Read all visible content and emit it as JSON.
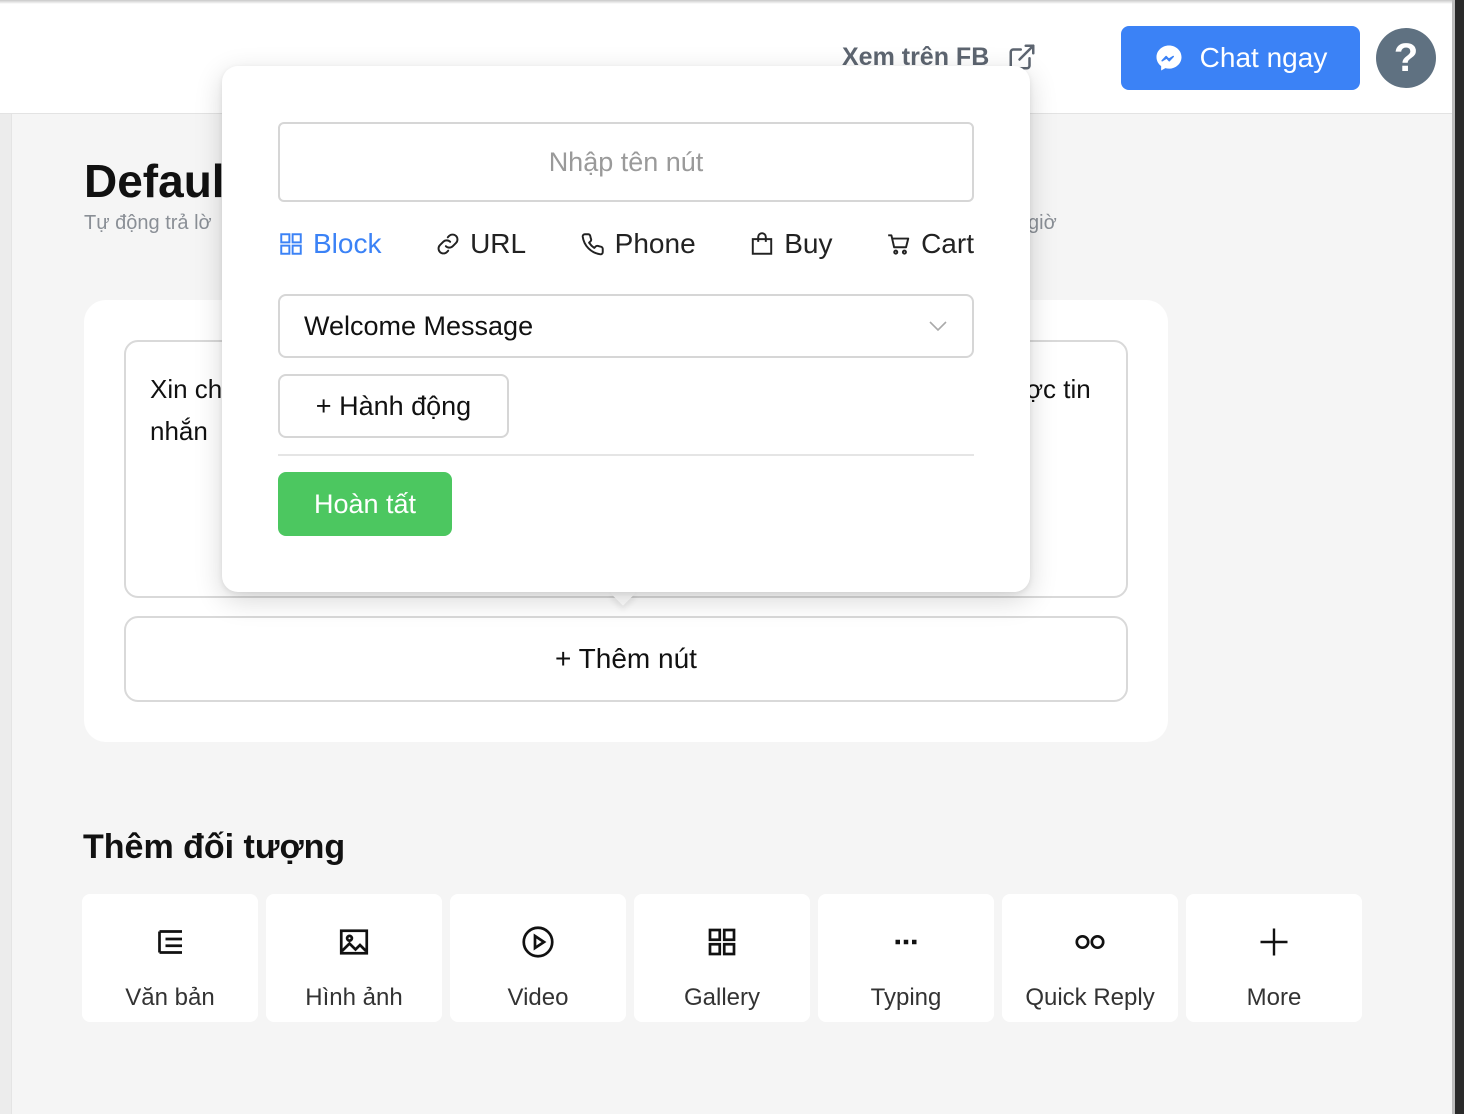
{
  "header": {
    "view_on_fb": "Xem trên FB",
    "chat_button": "Chat ngay",
    "help": "?"
  },
  "page": {
    "title": "Default",
    "subtitle": "Tự động trả lờ",
    "subtitle_tail": "giờ"
  },
  "message": {
    "text": "Xin ch",
    "text_line2": "nhắn",
    "text_tail": "ợc tin"
  },
  "add_button": "+ Thêm nút",
  "popover": {
    "name_placeholder": "Nhập tên nút",
    "name_value": "",
    "tabs": [
      {
        "label": "Block",
        "icon": "grid-icon",
        "active": true
      },
      {
        "label": "URL",
        "icon": "link-icon"
      },
      {
        "label": "Phone",
        "icon": "phone-icon"
      },
      {
        "label": "Buy",
        "icon": "bag-icon"
      },
      {
        "label": "Cart",
        "icon": "cart-icon"
      }
    ],
    "selected_block": "Welcome Message",
    "action_button": "+ Hành động",
    "done_button": "Hoàn tất"
  },
  "objects": {
    "title": "Thêm đối tượng",
    "items": [
      {
        "label": "Văn bản",
        "icon": "text-list-icon"
      },
      {
        "label": "Hình ảnh",
        "icon": "image-icon"
      },
      {
        "label": "Video",
        "icon": "play-circle-icon"
      },
      {
        "label": "Gallery",
        "icon": "grid-icon"
      },
      {
        "label": "Typing",
        "icon": "ellipsis-icon"
      },
      {
        "label": "Quick Reply",
        "icon": "two-circles-icon"
      },
      {
        "label": "More",
        "icon": "plus-icon"
      }
    ]
  },
  "colors": {
    "primary": "#3b82f6",
    "success": "#4cc760",
    "help_bg": "#5f7181"
  }
}
